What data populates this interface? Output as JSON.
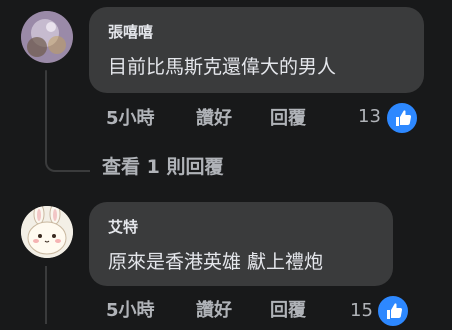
{
  "comments": [
    {
      "author": "張嘻嘻",
      "text": "目前比馬斯克還偉大的男人",
      "time": "5小時",
      "like_label": "讚好",
      "reply_label": "回覆",
      "like_count": "13"
    },
    {
      "author": "艾特",
      "text": "原來是香港英雄 獻上禮炮",
      "time": "5小時",
      "like_label": "讚好",
      "reply_label": "回覆",
      "like_count": "15"
    }
  ],
  "view_replies": "查看 1 則回覆",
  "colors": {
    "background": "#18191a",
    "bubble": "#3a3b3c",
    "like_blue": "#2d88ff",
    "secondary_text": "#b0b3b8"
  }
}
